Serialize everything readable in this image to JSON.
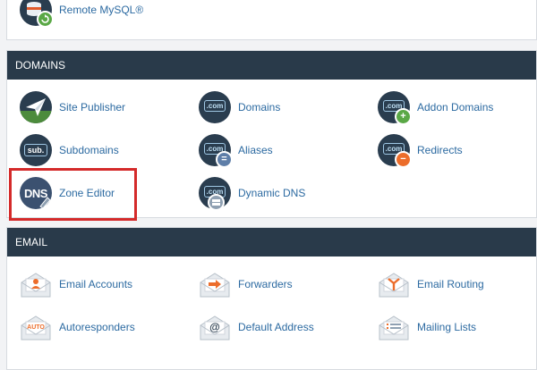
{
  "top": {
    "remote_mysql": "Remote MySQL®"
  },
  "domains": {
    "header": "DOMAINS",
    "site_publisher": "Site Publisher",
    "domains": "Domains",
    "addon_domains": "Addon Domains",
    "subdomains": "Subdomains",
    "aliases": "Aliases",
    "redirects": "Redirects",
    "zone_editor": "Zone Editor",
    "dynamic_dns": "Dynamic DNS"
  },
  "email": {
    "header": "EMAIL",
    "email_accounts": "Email Accounts",
    "forwarders": "Forwarders",
    "email_routing": "Email Routing",
    "autoresponders": "Autoresponders",
    "default_address": "Default Address",
    "mailing_lists": "Mailing Lists"
  },
  "icon_text": {
    "com": ".com",
    "sub": "sub.",
    "dns": "DNS",
    "auto": "AUTO",
    "at": "@"
  },
  "colors": {
    "header_bg": "#293a4a",
    "link": "#2c6aa1",
    "highlight": "#d42a2a",
    "icon_dark": "#2a3d4f",
    "badge_green": "#5aa846",
    "badge_orange": "#ec6d2b"
  }
}
